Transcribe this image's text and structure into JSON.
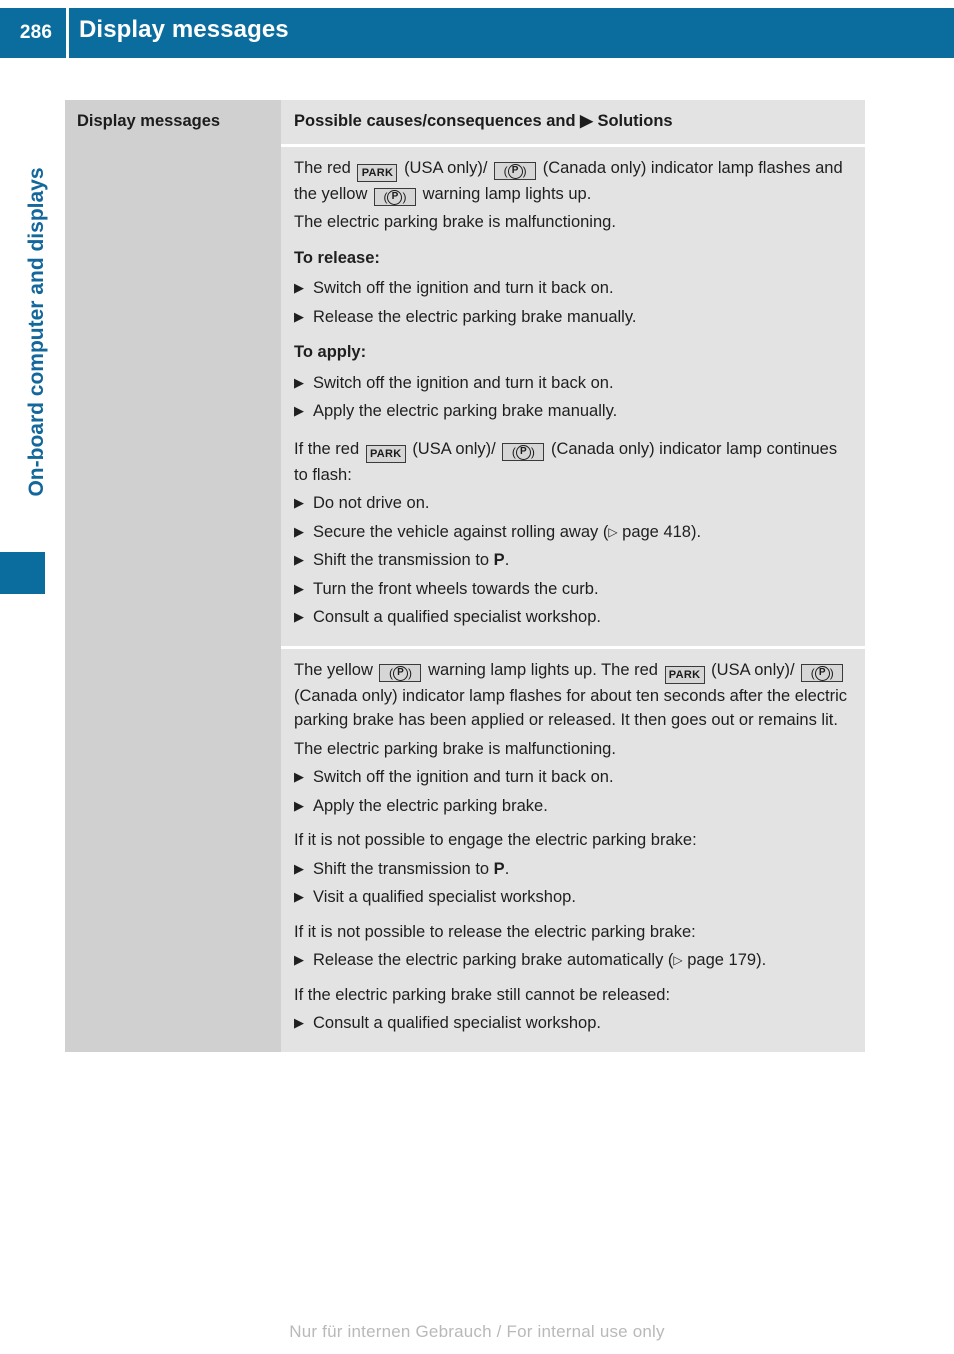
{
  "header": {
    "page_number": "286",
    "title": "Display messages"
  },
  "sidebar": {
    "chapter_label": "On-board computer and displays"
  },
  "table": {
    "columns": [
      "Display messages",
      "Possible causes/consequences and ▶ Solutions"
    ],
    "col_header_right_prefix": "Possible causes/consequences and",
    "col_header_right_suffix": "Solutions",
    "rows": [
      {
        "left": "",
        "blocks": [
          {
            "type": "para_icons",
            "id": "r1p1_a",
            "text_1": "The red",
            "text_2": "(USA only)/",
            "text_3": "(Canada only) indicator lamp flashes and the yellow",
            "text_4": "warning lamp lights up."
          },
          {
            "type": "para",
            "id": "r1p2",
            "text": "The electric parking brake is malfunctioning."
          },
          {
            "type": "heading",
            "id": "r1h1",
            "text": "To release:"
          },
          {
            "type": "bullet",
            "id": "r1b1",
            "text": "Switch off the ignition and turn it back on."
          },
          {
            "type": "bullet",
            "id": "r1b2",
            "text": "Release the electric parking brake manually."
          },
          {
            "type": "heading",
            "id": "r1h2",
            "text": "To apply:"
          },
          {
            "type": "bullet",
            "id": "r1b3",
            "text": "Switch off the ignition and turn it back on."
          },
          {
            "type": "bullet",
            "id": "r1b4",
            "text": "Apply the electric parking brake manually."
          },
          {
            "type": "para_icons",
            "id": "r1p3",
            "text_1": "If the red",
            "text_2": "(USA only)/",
            "text_3": "(Canada only) indicator lamp continues to flash:"
          },
          {
            "type": "bullet",
            "id": "r1b5",
            "text": "Do not drive on."
          },
          {
            "type": "bullet_ref",
            "id": "r1b6",
            "text_before": "Secure the vehicle against rolling away (",
            "ref": "page 418",
            "text_after": ")."
          },
          {
            "type": "bullet_bold",
            "id": "r1b7",
            "text_before": "Shift the transmission to ",
            "bold": "P",
            "text_after": "."
          },
          {
            "type": "bullet",
            "id": "r1b8",
            "text": "Turn the front wheels towards the curb."
          },
          {
            "type": "bullet",
            "id": "r1b9",
            "text": "Consult a qualified specialist workshop."
          }
        ]
      },
      {
        "left": "",
        "blocks": [
          {
            "type": "para_icons",
            "id": "r2p1",
            "text_1": "The yellow",
            "text_2": "warning lamp lights up. The red",
            "text_3": "(USA only)/",
            "text_4": "(Canada only) indicator lamp flashes for about ten seconds after the electric parking brake has been applied or released. It then goes out or remains lit."
          },
          {
            "type": "para",
            "id": "r2p2",
            "text": "The electric parking brake is malfunctioning."
          },
          {
            "type": "bullet",
            "id": "r2b1",
            "text": "Switch off the ignition and turn it back on."
          },
          {
            "type": "bullet",
            "id": "r2b2",
            "text": "Apply the electric parking brake."
          },
          {
            "type": "para",
            "id": "r2p3",
            "text": "If it is not possible to engage the electric parking brake:"
          },
          {
            "type": "bullet_bold",
            "id": "r2b3",
            "text_before": "Shift the transmission to ",
            "bold": "P",
            "text_after": "."
          },
          {
            "type": "bullet",
            "id": "r2b4",
            "text": "Visit a qualified specialist workshop."
          },
          {
            "type": "para",
            "id": "r2p4",
            "text": "If it is not possible to release the electric parking brake:"
          },
          {
            "type": "bullet_ref",
            "id": "r2b5",
            "text_before": "Release the electric parking brake automatically (",
            "ref": "page 179",
            "text_after": ")."
          },
          {
            "type": "para",
            "id": "r2p5",
            "text": "If the electric parking brake still cannot be released:"
          },
          {
            "type": "bullet",
            "id": "r2b6",
            "text": "Consult a qualified specialist workshop."
          }
        ]
      }
    ]
  },
  "icons": {
    "park_label": "PARK",
    "p_brake_label": "P",
    "solution_arrow": "▶",
    "bullet_arrow": "▶",
    "pageref_arrow": "▷"
  },
  "footer": {
    "text": "Nur für internen Gebrauch / For internal use only"
  },
  "colors": {
    "header_blue": "#0a6d9e",
    "chapter_blue": "#13679b",
    "col_left_gray": "#d0d0d0",
    "col_right_gray": "#e3e3e3",
    "text_dark": "#1f1f1f",
    "footer_gray": "#b9b9b9"
  }
}
